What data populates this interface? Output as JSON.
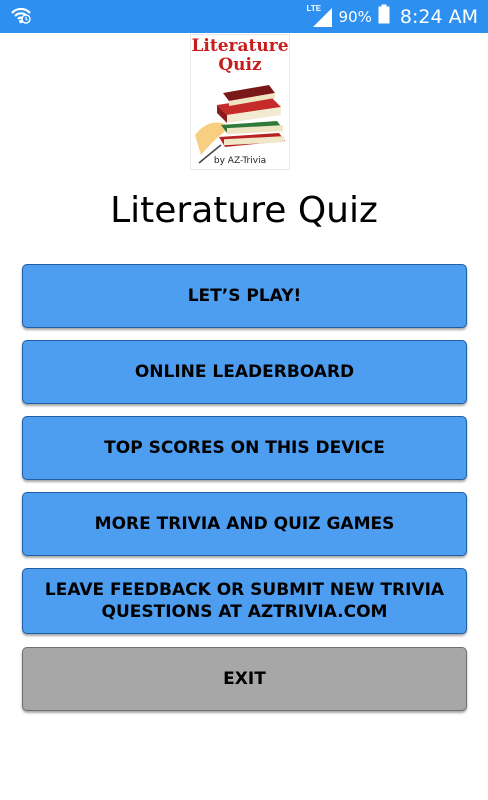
{
  "status_bar": {
    "network": "LTE",
    "battery": "90%",
    "time": "8:24 AM"
  },
  "logo": {
    "title_line1": "Literature",
    "title_line2": "Quiz",
    "byline": "by AZ-Trivia"
  },
  "title": "Literature Quiz",
  "menu": {
    "play": "LET’S PLAY!",
    "leaderboard": "ONLINE LEADERBOARD",
    "top_scores": "TOP SCORES ON THIS DEVICE",
    "more_games": "MORE TRIVIA AND QUIZ GAMES",
    "feedback": "LEAVE FEEDBACK OR SUBMIT NEW TRIVIA QUESTIONS AT AZTRIVIA.COM",
    "exit": "EXIT"
  },
  "colors": {
    "status_bar": "#2d8ff0",
    "button_blue": "#4d9df0",
    "button_exit": "#a7a7a7"
  }
}
